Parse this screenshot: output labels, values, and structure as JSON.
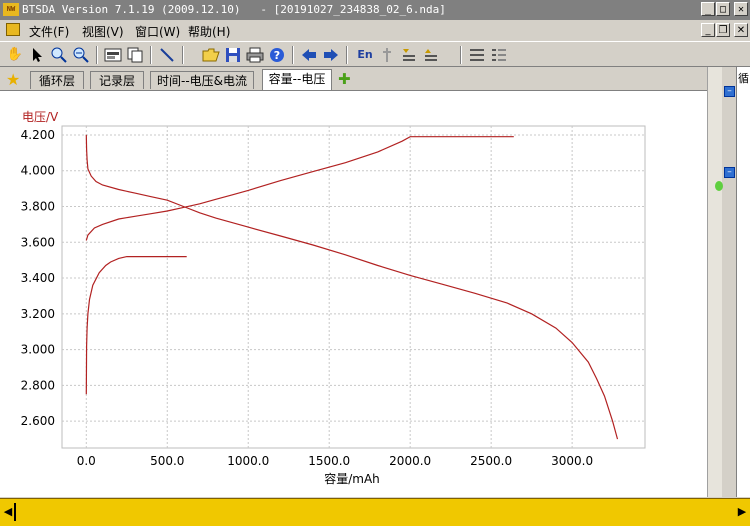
{
  "window": {
    "icon_text": "NW",
    "title": "BTSDA Version 7.1.19 (2009.12.10)   - [20191027_234838_02_6.nda]"
  },
  "menu": [
    {
      "label": "文件(F)"
    },
    {
      "label": "视图(V)"
    },
    {
      "label": "窗口(W)"
    },
    {
      "label": "帮助(H)"
    }
  ],
  "toolbar": {
    "lang_label": "En"
  },
  "tabs": [
    {
      "label": "循环层"
    },
    {
      "label": "记录层"
    },
    {
      "label": "时间--电压&电流"
    },
    {
      "label": "容量--电压",
      "active": true
    }
  ],
  "right_panel": {
    "label": "循"
  },
  "chart_data": {
    "type": "line",
    "ylabel": "电压/V",
    "xlabel": "容量/mAh",
    "xlim": [
      -150,
      3450
    ],
    "ylim": [
      2.45,
      4.25
    ],
    "x_ticks": [
      0,
      500,
      1000,
      1500,
      2000,
      2500,
      3000
    ],
    "x_tick_labels": [
      "0.0",
      "500.0",
      "1000.0",
      "1500.0",
      "2000.0",
      "2500.0",
      "3000.0"
    ],
    "y_ticks": [
      2.6,
      2.8,
      3.0,
      3.2,
      3.4,
      3.6,
      3.8,
      4.0,
      4.2
    ],
    "y_tick_labels": [
      "2.600",
      "2.800",
      "3.000",
      "3.200",
      "3.400",
      "3.600",
      "3.800",
      "4.000",
      "4.200"
    ],
    "grid": true,
    "color": "#b22222",
    "series": [
      {
        "x": [
          0,
          2,
          5,
          10,
          20,
          40,
          80,
          120,
          150,
          200,
          250,
          300,
          400,
          500,
          620
        ],
        "y": [
          2.75,
          3.02,
          3.12,
          3.2,
          3.28,
          3.36,
          3.43,
          3.47,
          3.49,
          3.51,
          3.52,
          3.52,
          3.52,
          3.52,
          3.52
        ]
      },
      {
        "x": [
          0,
          10,
          50,
          100,
          200,
          300,
          400,
          500,
          600,
          700,
          800,
          900,
          1000,
          1200,
          1400,
          1600,
          1800,
          1950,
          2000,
          2300,
          2640
        ],
        "y": [
          3.61,
          3.64,
          3.68,
          3.7,
          3.73,
          3.745,
          3.76,
          3.775,
          3.795,
          3.815,
          3.84,
          3.865,
          3.89,
          3.945,
          3.995,
          4.045,
          4.105,
          4.165,
          4.19,
          4.19,
          4.19
        ]
      },
      {
        "x": [
          0,
          2,
          5,
          10,
          30,
          60,
          100,
          200,
          300,
          400,
          500,
          600,
          700,
          800,
          1000,
          1200,
          1400,
          1600,
          1800,
          2000,
          2200,
          2400,
          2600,
          2750,
          2900,
          3000,
          3100,
          3150,
          3200,
          3250,
          3280
        ],
        "y": [
          4.2,
          4.12,
          4.06,
          4.01,
          3.97,
          3.94,
          3.92,
          3.895,
          3.875,
          3.855,
          3.835,
          3.8,
          3.765,
          3.735,
          3.685,
          3.635,
          3.585,
          3.53,
          3.47,
          3.415,
          3.365,
          3.315,
          3.26,
          3.2,
          3.12,
          3.04,
          2.93,
          2.84,
          2.74,
          2.6,
          2.5
        ]
      }
    ]
  }
}
